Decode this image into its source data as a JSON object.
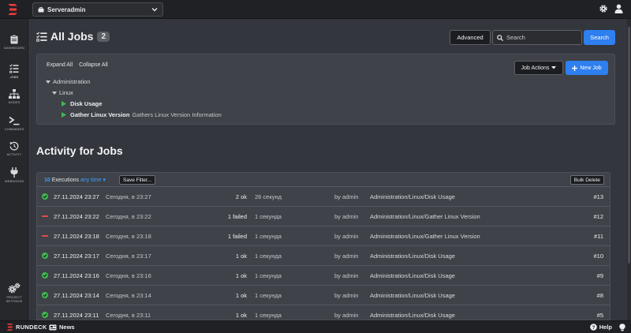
{
  "topbar": {
    "project": "Serveradmin"
  },
  "sidebar": {
    "items": [
      {
        "label": "DASHBOARD",
        "icon": "clipboard-icon"
      },
      {
        "label": "JOBS",
        "icon": "tasks-icon"
      },
      {
        "label": "NODES",
        "icon": "sitemap-icon"
      },
      {
        "label": "COMMANDS",
        "icon": "terminal-icon"
      },
      {
        "label": "ACTIVITY",
        "icon": "history-icon"
      },
      {
        "label": "WEBHOOKS",
        "icon": "plug-icon"
      }
    ],
    "settings": {
      "line1": "PROJECT",
      "line2": "SETTINGS",
      "icon": "gears-icon"
    }
  },
  "header": {
    "title": "All Jobs",
    "count": "2",
    "advanced_label": "Advanced",
    "search_placeholder": "Search",
    "search_value": "",
    "search_button": "Search"
  },
  "jobs_panel": {
    "expand_all": "Expand All",
    "collapse_all": "Collapse All",
    "job_actions": "Job Actions",
    "new_job": "New Job",
    "group": "Administration",
    "subgroup": "Linux",
    "jobs": [
      {
        "name": "Disk Usage",
        "description": ""
      },
      {
        "name": "Gather Linux Version",
        "description": "Gathers Linux Version Information"
      }
    ]
  },
  "activity": {
    "title": "Activity for Jobs",
    "exec_count": "10",
    "exec_label": "Executions",
    "time_filter": "any time",
    "save_filter": "Save Filter...",
    "bulk_delete": "Bulk Delete",
    "rows": [
      {
        "status": "ok",
        "date": "27.11.2024 23:27",
        "relative": "Сегодня, в 23:27",
        "count": "2 ok",
        "duration": "26 секунд",
        "user": "by admin",
        "job": "Administration/Linux/Disk Usage",
        "id": "#13"
      },
      {
        "status": "failed",
        "date": "27.11.2024 23:22",
        "relative": "Сегодня, в 23:22",
        "count": "1 failed",
        "duration": "1 секунда",
        "user": "by admin",
        "job": "Administration/Linux/Gather Linux Version",
        "id": "#12"
      },
      {
        "status": "failed",
        "date": "27.11.2024 23:18",
        "relative": "Сегодня, в 23:18",
        "count": "1 failed",
        "duration": "1 секунда",
        "user": "by admin",
        "job": "Administration/Linux/Gather Linux Version",
        "id": "#11"
      },
      {
        "status": "ok",
        "date": "27.11.2024 23:17",
        "relative": "Сегодня, в 23:17",
        "count": "1 ok",
        "duration": "1 секунда",
        "user": "by admin",
        "job": "Administration/Linux/Disk Usage",
        "id": "#10"
      },
      {
        "status": "ok",
        "date": "27.11.2024 23:16",
        "relative": "Сегодня, в 23:16",
        "count": "1 ok",
        "duration": "1 секунда",
        "user": "by admin",
        "job": "Administration/Linux/Disk Usage",
        "id": "#9"
      },
      {
        "status": "ok",
        "date": "27.11.2024 23:14",
        "relative": "Сегодня, в 23:14",
        "count": "1 ok",
        "duration": "1 секунда",
        "user": "by admin",
        "job": "Administration/Linux/Disk Usage",
        "id": "#8"
      },
      {
        "status": "ok",
        "date": "27.11.2024 23:11",
        "relative": "Сегодня, в 23:11",
        "count": "1 ok",
        "duration": "1 секунда",
        "user": "by admin",
        "job": "Administration/Linux/Disk Usage",
        "id": "#5"
      }
    ]
  },
  "footer": {
    "brand": "RUNDECK",
    "news": "News",
    "help": "Help"
  },
  "colors": {
    "accent": "#2e7ff0",
    "ok": "#3fb950",
    "failed": "#e5484d",
    "brand_red": "#ef3b3b"
  }
}
